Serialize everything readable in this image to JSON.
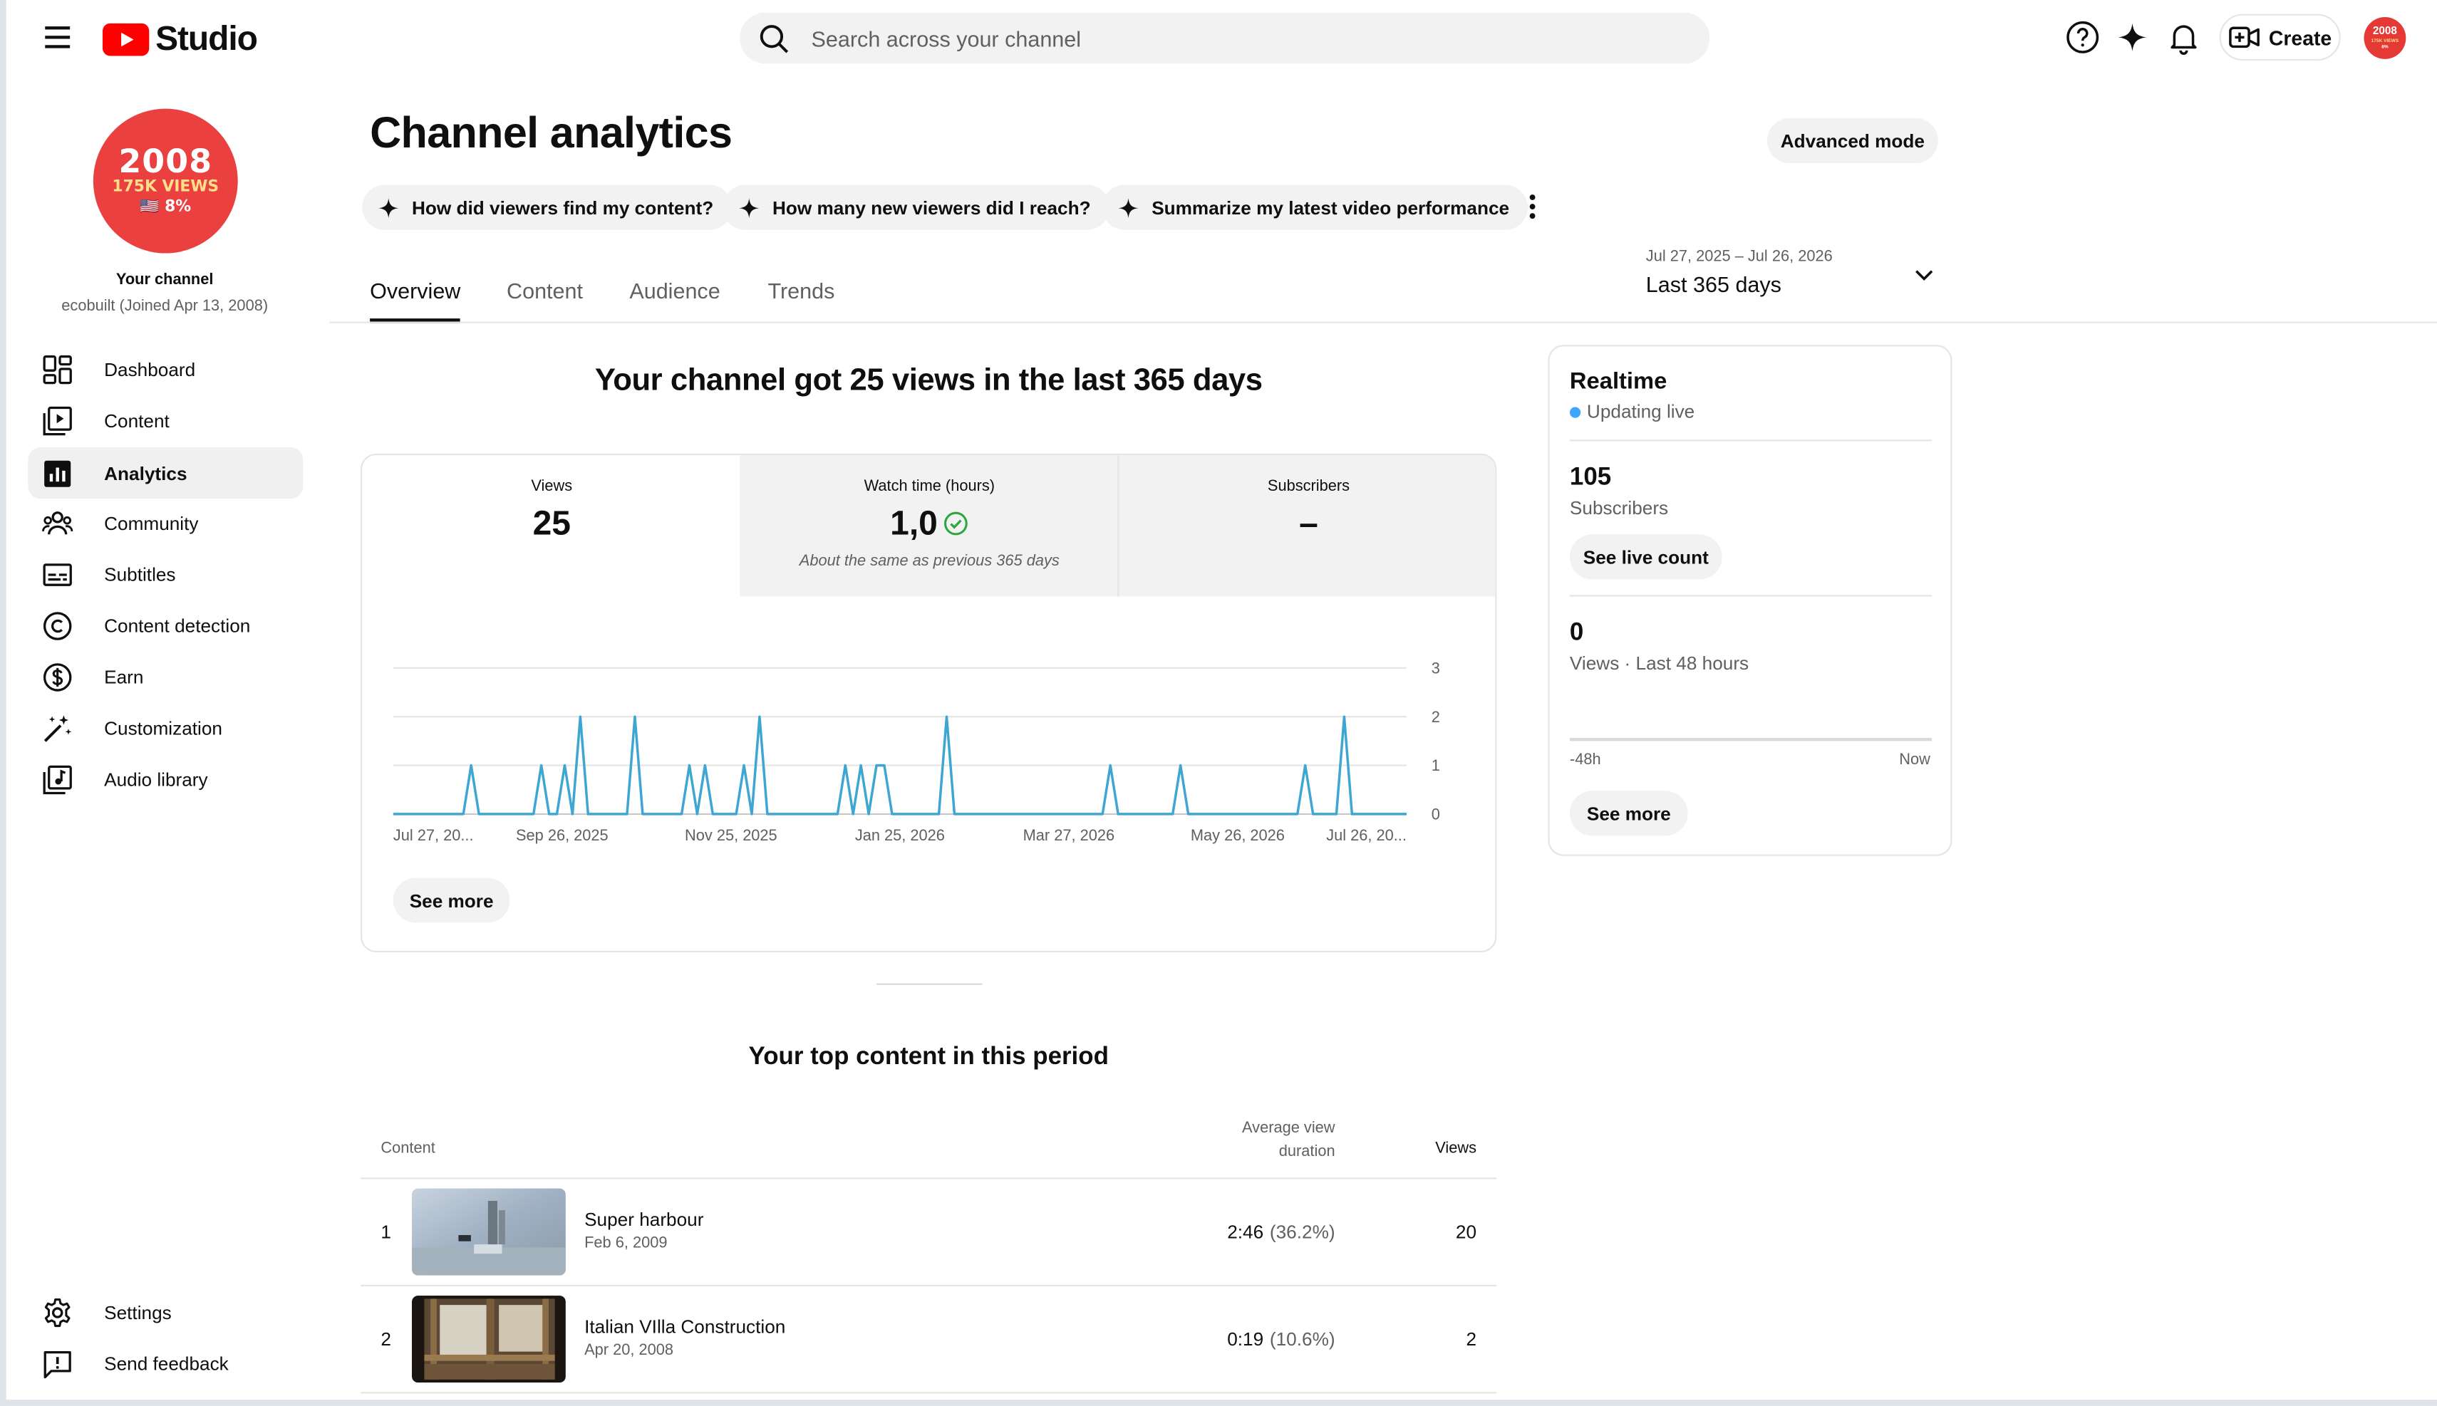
{
  "header": {
    "logo_text": "Studio",
    "search_placeholder": "Search across your channel",
    "create_label": "Create",
    "avatar_small_lines": [
      "2008",
      "175K VIEWS",
      "8%"
    ]
  },
  "sidebar": {
    "avatar_lines": [
      "2008",
      "175K VIEWS",
      "🇺🇸 8%"
    ],
    "channel_label": "Your channel",
    "channel_sub": "ecobuilt (Joined Apr 13, 2008)",
    "items": [
      {
        "label": "Dashboard",
        "icon": "dashboard-icon"
      },
      {
        "label": "Content",
        "icon": "content-icon"
      },
      {
        "label": "Analytics",
        "icon": "analytics-icon",
        "active": true
      },
      {
        "label": "Community",
        "icon": "community-icon"
      },
      {
        "label": "Subtitles",
        "icon": "subtitles-icon"
      },
      {
        "label": "Content detection",
        "icon": "copyright-icon"
      },
      {
        "label": "Earn",
        "icon": "dollar-icon"
      },
      {
        "label": "Customization",
        "icon": "magic-wand-icon"
      },
      {
        "label": "Audio library",
        "icon": "audio-library-icon"
      }
    ],
    "bottom_items": [
      {
        "label": "Settings",
        "icon": "gear-icon"
      },
      {
        "label": "Send feedback",
        "icon": "feedback-icon"
      }
    ]
  },
  "main": {
    "title": "Channel analytics",
    "advanced_mode_label": "Advanced mode",
    "chips": [
      "How did viewers find my content?",
      "How many new viewers did I reach?",
      "Summarize my latest video performance"
    ],
    "tabs": [
      "Overview",
      "Content",
      "Audience",
      "Trends"
    ],
    "active_tab": "Overview",
    "date_range": {
      "dates": "Jul 27, 2025 – Jul 26, 2026",
      "label": "Last 365 days"
    },
    "headline": "Your channel got 25 views in the last 365 days",
    "metrics": [
      {
        "label": "Views",
        "value": "25",
        "note": ""
      },
      {
        "label": "Watch time (hours)",
        "value": "1,0",
        "note": "About the same as previous 365 days"
      },
      {
        "label": "Subscribers",
        "value": "–",
        "note": ""
      }
    ],
    "see_more_label": "See more"
  },
  "chart_data": {
    "type": "line",
    "series": [
      {
        "name": "Views",
        "values": [
          0,
          0,
          0,
          0,
          0,
          0,
          0,
          0,
          0,
          0,
          1,
          0,
          0,
          0,
          0,
          0,
          0,
          0,
          0,
          1,
          0,
          0,
          1,
          0,
          2,
          0,
          0,
          0,
          0,
          0,
          0,
          2,
          0,
          0,
          0,
          0,
          0,
          0,
          1,
          0,
          1,
          0,
          0,
          0,
          0,
          1,
          0,
          2,
          0,
          0,
          0,
          0,
          0,
          0,
          0,
          0,
          0,
          0,
          1,
          0,
          1,
          0,
          1,
          1,
          0,
          0,
          0,
          0,
          0,
          0,
          0,
          2,
          0,
          0,
          0,
          0,
          0,
          0,
          0,
          0,
          0,
          0,
          0,
          0,
          0,
          0,
          0,
          0,
          0,
          0,
          0,
          0,
          1,
          0,
          0,
          0,
          0,
          0,
          0,
          0,
          0,
          1,
          0,
          0,
          0,
          0,
          0,
          0,
          0,
          0,
          0,
          0,
          0,
          0,
          0,
          0,
          0,
          1,
          0,
          0,
          0,
          0,
          2,
          0,
          0,
          0,
          0,
          0,
          0,
          0,
          0
        ]
      }
    ],
    "x_start": "Jul 27, 2025",
    "x_end": "Jul 26, 2026",
    "x_tick_labels": [
      "Jul 27, 20...",
      "Sep 26, 2025",
      "Nov 25, 2025",
      "Jan 25, 2026",
      "Mar 27, 2026",
      "May 26, 2026",
      "Jul 26, 20..."
    ],
    "y_ticks": [
      0,
      1,
      2,
      3
    ],
    "ylim": [
      0,
      3
    ],
    "grid": true,
    "line_color": "#3ea6d3"
  },
  "realtime": {
    "title": "Realtime",
    "status": "Updating live",
    "status_color": "#3ea6ff",
    "subscribers_value": "105",
    "subscribers_label": "Subscribers",
    "live_count_label": "See live count",
    "views_value": "0",
    "views_label": "Views · Last 48 hours",
    "axis_left": "-48h",
    "axis_right": "Now",
    "see_more_label": "See more"
  },
  "top_content": {
    "title": "Your top content in this period",
    "columns": {
      "content": "Content",
      "duration_line1": "Average view",
      "duration_line2": "duration",
      "views": "Views"
    },
    "rows": [
      {
        "rank": "1",
        "title": "Super harbour",
        "date": "Feb 6, 2009",
        "duration": "2:46",
        "percent": "(36.2%)",
        "views": "20"
      },
      {
        "rank": "2",
        "title": "Italian VIlla Construction",
        "date": "Apr 20, 2008",
        "duration": "0:19",
        "percent": "(10.6%)",
        "views": "2"
      }
    ]
  },
  "colors": {
    "accent": "#0f0f0f",
    "brand_red": "#ff0000",
    "chart_line": "#3ea6d3"
  }
}
